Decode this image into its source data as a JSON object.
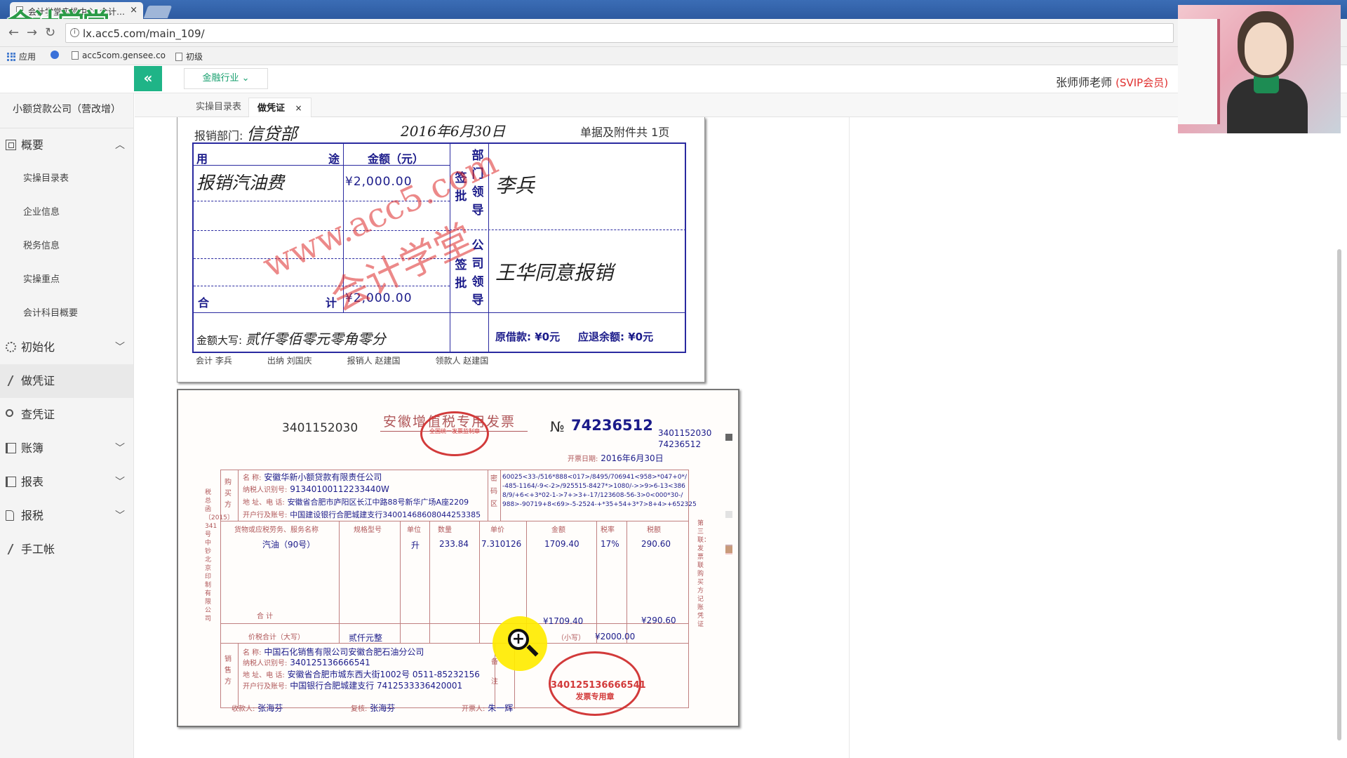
{
  "browser": {
    "tab_title": "会计学堂实操中心_会计…",
    "tab_close": "×",
    "logo_text": "会计学堂",
    "url": "lx.acc5.com/main_109/",
    "bookmarks": [
      "应用",
      "acc5com.gensee.co",
      "初级"
    ]
  },
  "header": {
    "collapse_symbol": "«",
    "industry_label": "金融行业 ⌄",
    "user_name": "张师师老师",
    "user_badge": "(SVIP会员)"
  },
  "sidebar": {
    "company": "小额贷款公司（营改增）",
    "overview": "概要",
    "overview_subitems": [
      "实操目录表",
      "企业信息",
      "税务信息",
      "实操重点",
      "会计科目概要"
    ],
    "init": "初始化",
    "make_voucher": "做凭证",
    "query_voucher": "查凭证",
    "ledger": "账簿",
    "report": "报表",
    "tax": "报税",
    "manual": "手工帐"
  },
  "tabs": {
    "tab1": "实操目录表",
    "tab2": "做凭证",
    "tab2_close": "×"
  },
  "reimbursement": {
    "dept_label": "报销部门:",
    "dept_value": "信贷部",
    "date": "2016年6月30日",
    "attach_label": "单据及附件共  1页",
    "col_use_a": "用",
    "col_use_b": "途",
    "col_amount": "金额（元）",
    "row1_use": "报销汽油费",
    "row1_amount": "¥2,000.00",
    "total_a": "合",
    "total_b": "计",
    "total_amount": "¥2,000.00",
    "dept_sign_label": "签批",
    "dept_leader_label": "部门领导",
    "dept_leader_sign": "李兵",
    "company_sign_label": "签批",
    "company_leader_label": "公司领导",
    "company_leader_sign": "王华同意报销",
    "capital_label": "金额大写:",
    "capital_value": "贰仟零佰零元零角零分",
    "advance": "原借款: ¥0元",
    "refund": "应退余额: ¥0元",
    "sign_accountant": "会计 李兵",
    "sign_cashier": "出纳 刘国庆",
    "sign_reimburser": "报销人 赵建国",
    "sign_receiver": "领款人 赵建国",
    "watermark_url": "www.acc5.com",
    "watermark_cn": "会计学堂"
  },
  "invoice": {
    "code_left": "3401152030",
    "title": "安徽增值税专用发票",
    "no_symbol": "№",
    "number": "74236512",
    "code_right": "3401152030",
    "number_right": "74236512",
    "issue_date_label": "开票日期:",
    "issue_date": "2016年6月30日",
    "buyer_side_label": "购买方",
    "buyer_name_label": "名      称:",
    "buyer_name": "安徽华新小额贷款有限责任公司",
    "buyer_tax_label": "纳税人识别号:",
    "buyer_tax": "91340100112233440W",
    "buyer_addr_label": "地 址、电 话:",
    "buyer_addr": "安徽省合肥市庐阳区长江中路88号新华广场A座2209",
    "buyer_bank_label": "开户行及账号:",
    "buyer_bank": "中国建设银行合肥城建支行34001468608044253385",
    "cipher_label": "密码区",
    "cipher": [
      "60025<33-/516*888<017>/8495/706941<958>*047+0*/",
      "-485-1164/-9<-2>/925515-8427*>1080/->>9>6-13<386",
      "8/9/+6<+3*02-1->7+>3+-17/123608-56-3>0<000*30-/",
      "988>-90719+8<69>-5-2524-+*35+54+3*7>8+4>+652325"
    ],
    "goods_header": "货物或应税劳务、服务名称",
    "spec_header": "规格型号",
    "unit_header": "单位",
    "qty_header": "数量",
    "price_header": "单价",
    "amount_header": "金额",
    "rate_header": "税率",
    "tax_header": "税额",
    "goods": "汽油（90号）",
    "unit": "升",
    "qty": "233.84",
    "price": "7.310126",
    "amount": "1709.40",
    "rate": "17%",
    "tax": "290.60",
    "total_label": "合          计",
    "total_amount": "¥1709.40",
    "total_tax": "¥290.60",
    "total_capital_label": "价税合计（大写）",
    "total_capital": "贰仟元整",
    "small_label": "（小写）",
    "small_value": "¥2000.00",
    "seller_side_label": "销售方",
    "seller_name_label": "名      称:",
    "seller_name": "中国石化销售有限公司安徽合肥石油分公司",
    "seller_tax_label": "纳税人识别号:",
    "seller_tax": "340125136666541",
    "seller_addr_label": "地 址、电 话:",
    "seller_addr": "安徽省合肥市城东西大街1002号 0511-85232156",
    "seller_bank_label": "开户行及账号:",
    "seller_bank": "中国银行合肥城建支行 7412533336420001",
    "remark_label": "备注",
    "payee_label": "收款人:",
    "payee": "张海芬",
    "reviewer_label": "复核:",
    "reviewer": "张海芬",
    "drawer_label": "开票人:",
    "drawer": "朱一辉",
    "seal_number": "340125136666541",
    "seal_caption": "发票专用章",
    "left_vertical": "税总函〔2015〕341号中钞北京印制有限公司",
    "right_vertical": "第三联：发票联 购买方记账凭证",
    "stamp_top": "全国统一发票监制章"
  },
  "colors": {
    "accent": "#1fb487",
    "vip": "#e0302f",
    "form_ink": "#1b1b8a",
    "stamp_red": "#d23a3a"
  }
}
